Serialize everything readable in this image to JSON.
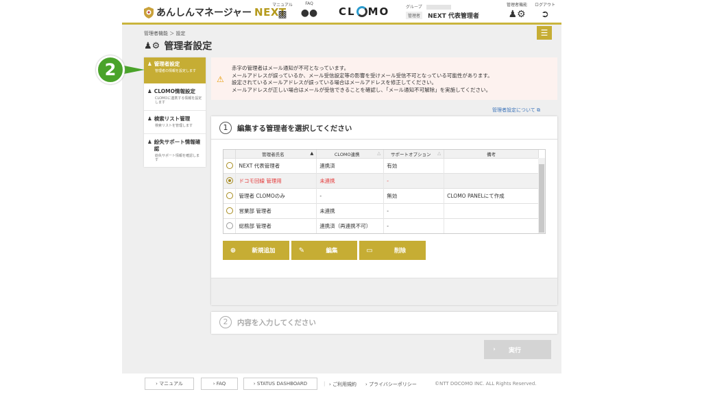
{
  "header": {
    "logo_text": "あんしんマネージャー",
    "logo_next": "NEXT",
    "manual_label": "マニュアル",
    "faq_label": "FAQ",
    "clomo_logo": "CLOMO",
    "group_label": "グループ",
    "admin_tag": "管理者",
    "admin_name": "NEXT 代表管理者",
    "admin_func_label": "管理者機能",
    "logout_label": "ログアウト"
  },
  "breadcrumb": "管理者機能 ＞ 設定",
  "page_title": "管理者設定",
  "step_badge": "2",
  "sidebar": {
    "items": [
      {
        "title": "管理者設定",
        "sub": "管理者の情報を設定します"
      },
      {
        "title": "CLOMO情報設定",
        "sub": "CLOMOに連携する情報を設定します"
      },
      {
        "title": "検索リスト管理",
        "sub": "検索リストを管理します"
      },
      {
        "title": "紛失サポート情報確認",
        "sub": "紛失サポート情報を確認します"
      }
    ]
  },
  "warning": {
    "line1": "赤字の管理者はメール通知が不可となっています。",
    "line2": "メールアドレスが誤っているか、メール受信設定等の影響を受けメール受信不可となっている可能性があります。",
    "line3": "設定されているメールアドレスが誤っている場合はメールアドレスを修正してください。",
    "line4": "メールアドレスが正しい場合はメールが受信できることを確認し、「メール通知不可解除」を実施してください。"
  },
  "about_link": "管理者設定について",
  "section1": {
    "number": "1",
    "title": "編集する管理者を選択してください"
  },
  "table": {
    "headers": [
      "管理者氏名",
      "CLOMO連携",
      "サポートオプション",
      "備考"
    ],
    "rows": [
      {
        "name": "NEXT 代表管理者",
        "clomo": "連携済",
        "support": "有効",
        "note": ""
      },
      {
        "name": "ドコモ回線 管理用",
        "clomo": "未連携",
        "support": "-",
        "note": ""
      },
      {
        "name": "管理者 CLOMOのみ",
        "clomo": "-",
        "support": "無効",
        "note": "CLOMO PANELにて作成"
      },
      {
        "name": "営業部 管理者",
        "clomo": "未連携",
        "support": "-",
        "note": ""
      },
      {
        "name": "総務部 管理者",
        "clomo": "連携済（再連携不可）",
        "support": "-",
        "note": ""
      }
    ]
  },
  "buttons": {
    "add": "新規追加",
    "edit": "編集",
    "delete": "削除"
  },
  "section2": {
    "number": "2",
    "title": "内容を入力してください"
  },
  "exec_button": "実行",
  "footer": {
    "manual": "マニュアル",
    "faq": "FAQ",
    "status": "STATUS DASHBOARD",
    "terms": "ご利用規約",
    "privacy": "プライバシーポリシー",
    "copyright": "©NTT DOCOMO INC. ALL Rights Reserved."
  },
  "colors": {
    "accent": "#c6ad34",
    "badge": "#4aa32a",
    "warning_bg": "#fdf2ef",
    "error_text": "#e43a3a"
  }
}
